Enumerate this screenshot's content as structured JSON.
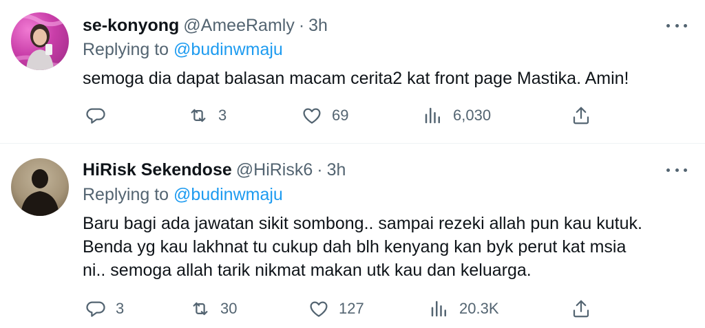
{
  "tweets": [
    {
      "display_name": "se-konyong",
      "handle": "@AmeeRamly",
      "separator": "·",
      "time": "3h",
      "replying_label": "Replying to",
      "replying_to": "@budinwmaju",
      "text": "semoga dia dapat balasan macam cerita2 kat front page Mastika. Amin!",
      "replies": "",
      "retweets": "3",
      "likes": "69",
      "views": "6,030"
    },
    {
      "display_name": "HiRisk Sekendose",
      "handle": "@HiRisk6",
      "separator": "·",
      "time": "3h",
      "replying_label": "Replying to",
      "replying_to": "@budinwmaju",
      "text_lines": [
        "Baru bagi ada jawatan sikit sombong.. sampai rezeki allah pun kau kutuk.",
        "Benda yg kau lakhnat tu cukup dah blh kenyang kan byk perut kat msia",
        "ni.. semoga allah tarik nikmat makan utk kau dan keluarga."
      ],
      "replies": "3",
      "retweets": "30",
      "likes": "127",
      "views": "20.3K"
    }
  ],
  "icons": {
    "reply": "reply-icon",
    "retweet": "retweet-icon",
    "like": "heart-icon",
    "views": "views-icon",
    "share": "share-icon",
    "more": "more-icon"
  },
  "colors": {
    "link": "#1d9bf0",
    "secondary_text": "#536471",
    "primary_text": "#0f1419",
    "divider": "#eff3f4"
  }
}
